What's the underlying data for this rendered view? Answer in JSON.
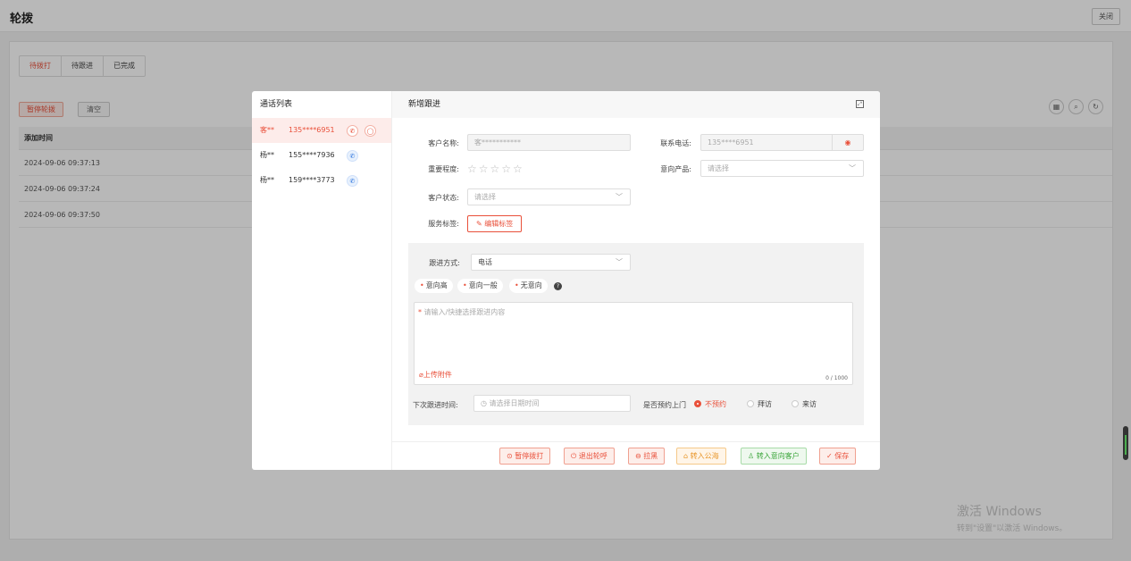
{
  "page": {
    "title": "轮拨",
    "close_label": "关闭"
  },
  "tabs": [
    {
      "label": "待拨打"
    },
    {
      "label": "待跟进"
    },
    {
      "label": "已完成"
    }
  ],
  "toolbar": {
    "pause_label": "暂停轮拨",
    "clear_label": "清空"
  },
  "tool_icons": [
    "grid-icon",
    "search-icon",
    "refresh-icon"
  ],
  "table": {
    "header": "添加时间",
    "rows": [
      "2024-09-06 09:37:13",
      "2024-09-06 09:37:24",
      "2024-09-06 09:37:50"
    ]
  },
  "watermark": {
    "line1": "激活 Windows",
    "line2": "转到\"设置\"以激活 Windows。"
  },
  "modal": {
    "call_list": {
      "title": "通话列表",
      "items": [
        {
          "name": "客**",
          "phone": "135****6951",
          "active": true
        },
        {
          "name": "杨**",
          "phone": "155****7936",
          "active": false
        },
        {
          "name": "杨**",
          "phone": "159****3773",
          "active": false
        }
      ]
    },
    "form": {
      "title": "新增跟进",
      "customer_name": {
        "label": "客户名称:",
        "value": "客***********"
      },
      "phone": {
        "label": "联系电话:",
        "value": "135****6951"
      },
      "importance": {
        "label": "重要程度:",
        "stars": "☆☆☆☆☆",
        "rating": 0
      },
      "product": {
        "label": "意向产品:",
        "placeholder": "请选择"
      },
      "status": {
        "label": "客户状态:",
        "placeholder": "请选择"
      },
      "tags": {
        "label": "服务标签:",
        "button": "编辑标签"
      },
      "followup": {
        "method_label": "跟进方式:",
        "method_value": "电话",
        "pills": [
          "意向高",
          "意向一般",
          "无意向"
        ],
        "placeholder": "请输入/快捷选择跟进内容",
        "upload": "上传附件",
        "counter": "0 / 1000",
        "next_time_label": "下次跟进时间:",
        "next_time_placeholder": "请选择日期时间",
        "visit_label": "是否预约上门",
        "visit_options": [
          "不预约",
          "拜访",
          "来访"
        ],
        "visit_selected": "不预约"
      }
    },
    "footer": {
      "buttons": [
        "暂停拨打",
        "退出轮呼",
        "拉黑",
        "转入公海",
        "转入意向客户",
        "保存"
      ]
    }
  },
  "colors": {
    "accent": "#e9503a",
    "orange": "#e8962a",
    "green": "#3aa53a",
    "phone_blue": "#3a7de0"
  }
}
